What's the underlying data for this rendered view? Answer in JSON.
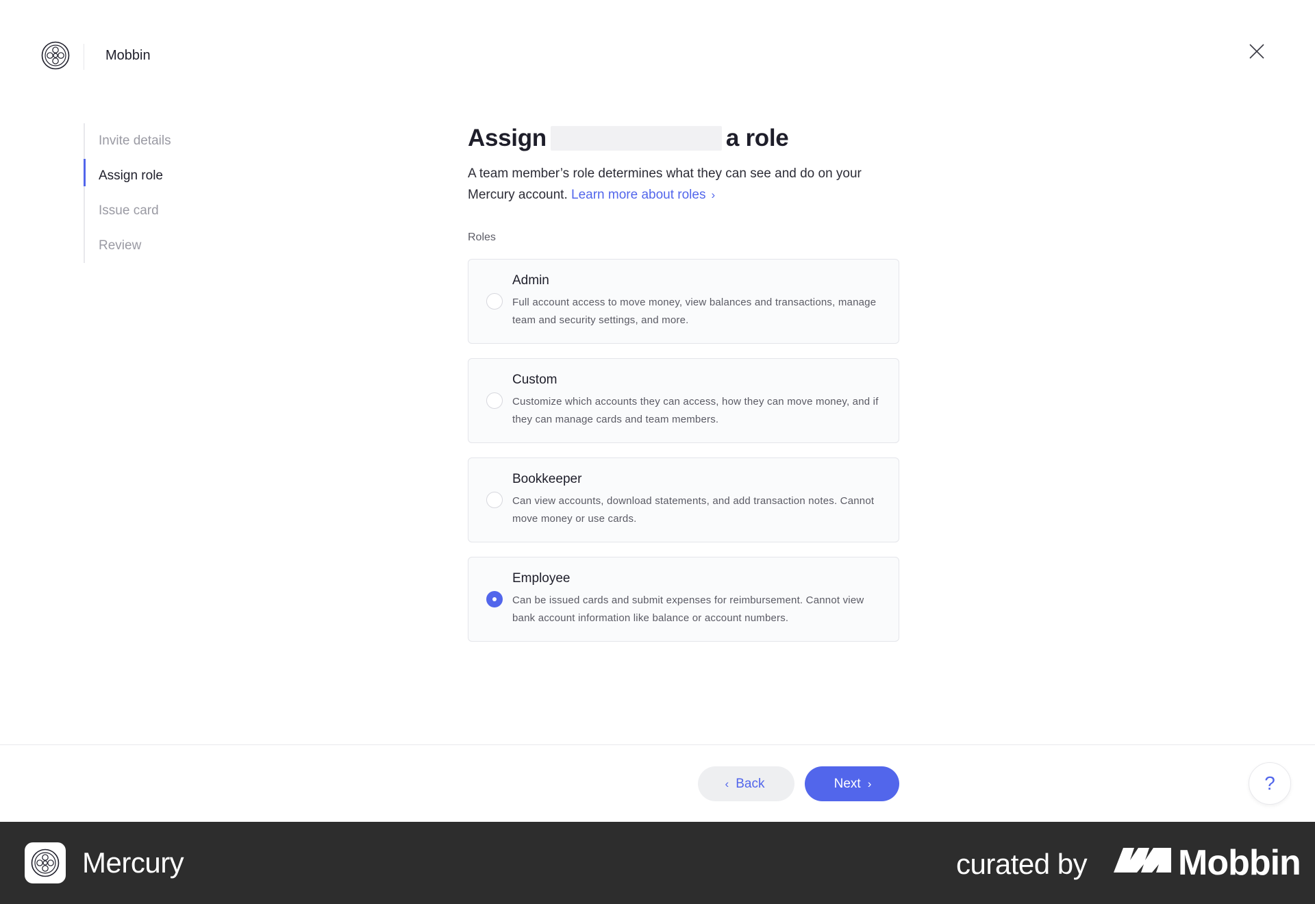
{
  "header": {
    "org_name": "Mobbin",
    "logo_icon": "mercury-logo-icon",
    "close_icon": "close-icon"
  },
  "stepper": {
    "steps": [
      {
        "label": "Invite details",
        "active": false
      },
      {
        "label": "Assign role",
        "active": true
      },
      {
        "label": "Issue card",
        "active": false
      },
      {
        "label": "Review",
        "active": false
      }
    ]
  },
  "main": {
    "title_prefix": "Assign",
    "title_suffix": "a role",
    "description": "A team member’s role determines what they can see and do on your Mercury account.",
    "learn_more": "Learn more about roles",
    "roles_label": "Roles",
    "roles": [
      {
        "name": "Admin",
        "description": "Full account access to move money, view balances and transactions, manage team and security settings, and more.",
        "selected": false
      },
      {
        "name": "Custom",
        "description": "Customize which accounts they can access, how they can move money, and if they can manage cards and team members.",
        "selected": false
      },
      {
        "name": "Bookkeeper",
        "description": "Can view accounts, download statements, and add transaction notes. Cannot move money or use cards.",
        "selected": false
      },
      {
        "name": "Employee",
        "description": "Can be issued cards and submit expenses for reimbursement. Cannot view bank account information like balance or account numbers.",
        "selected": true
      }
    ]
  },
  "footer": {
    "back_label": "Back",
    "next_label": "Next",
    "help_label": "?"
  },
  "brand_bar": {
    "app_name": "Mercury",
    "curated_by": "curated by",
    "mobbin": "Mobbin"
  },
  "colors": {
    "accent": "#5266eb",
    "brand_bar": "#2d2d2d"
  }
}
